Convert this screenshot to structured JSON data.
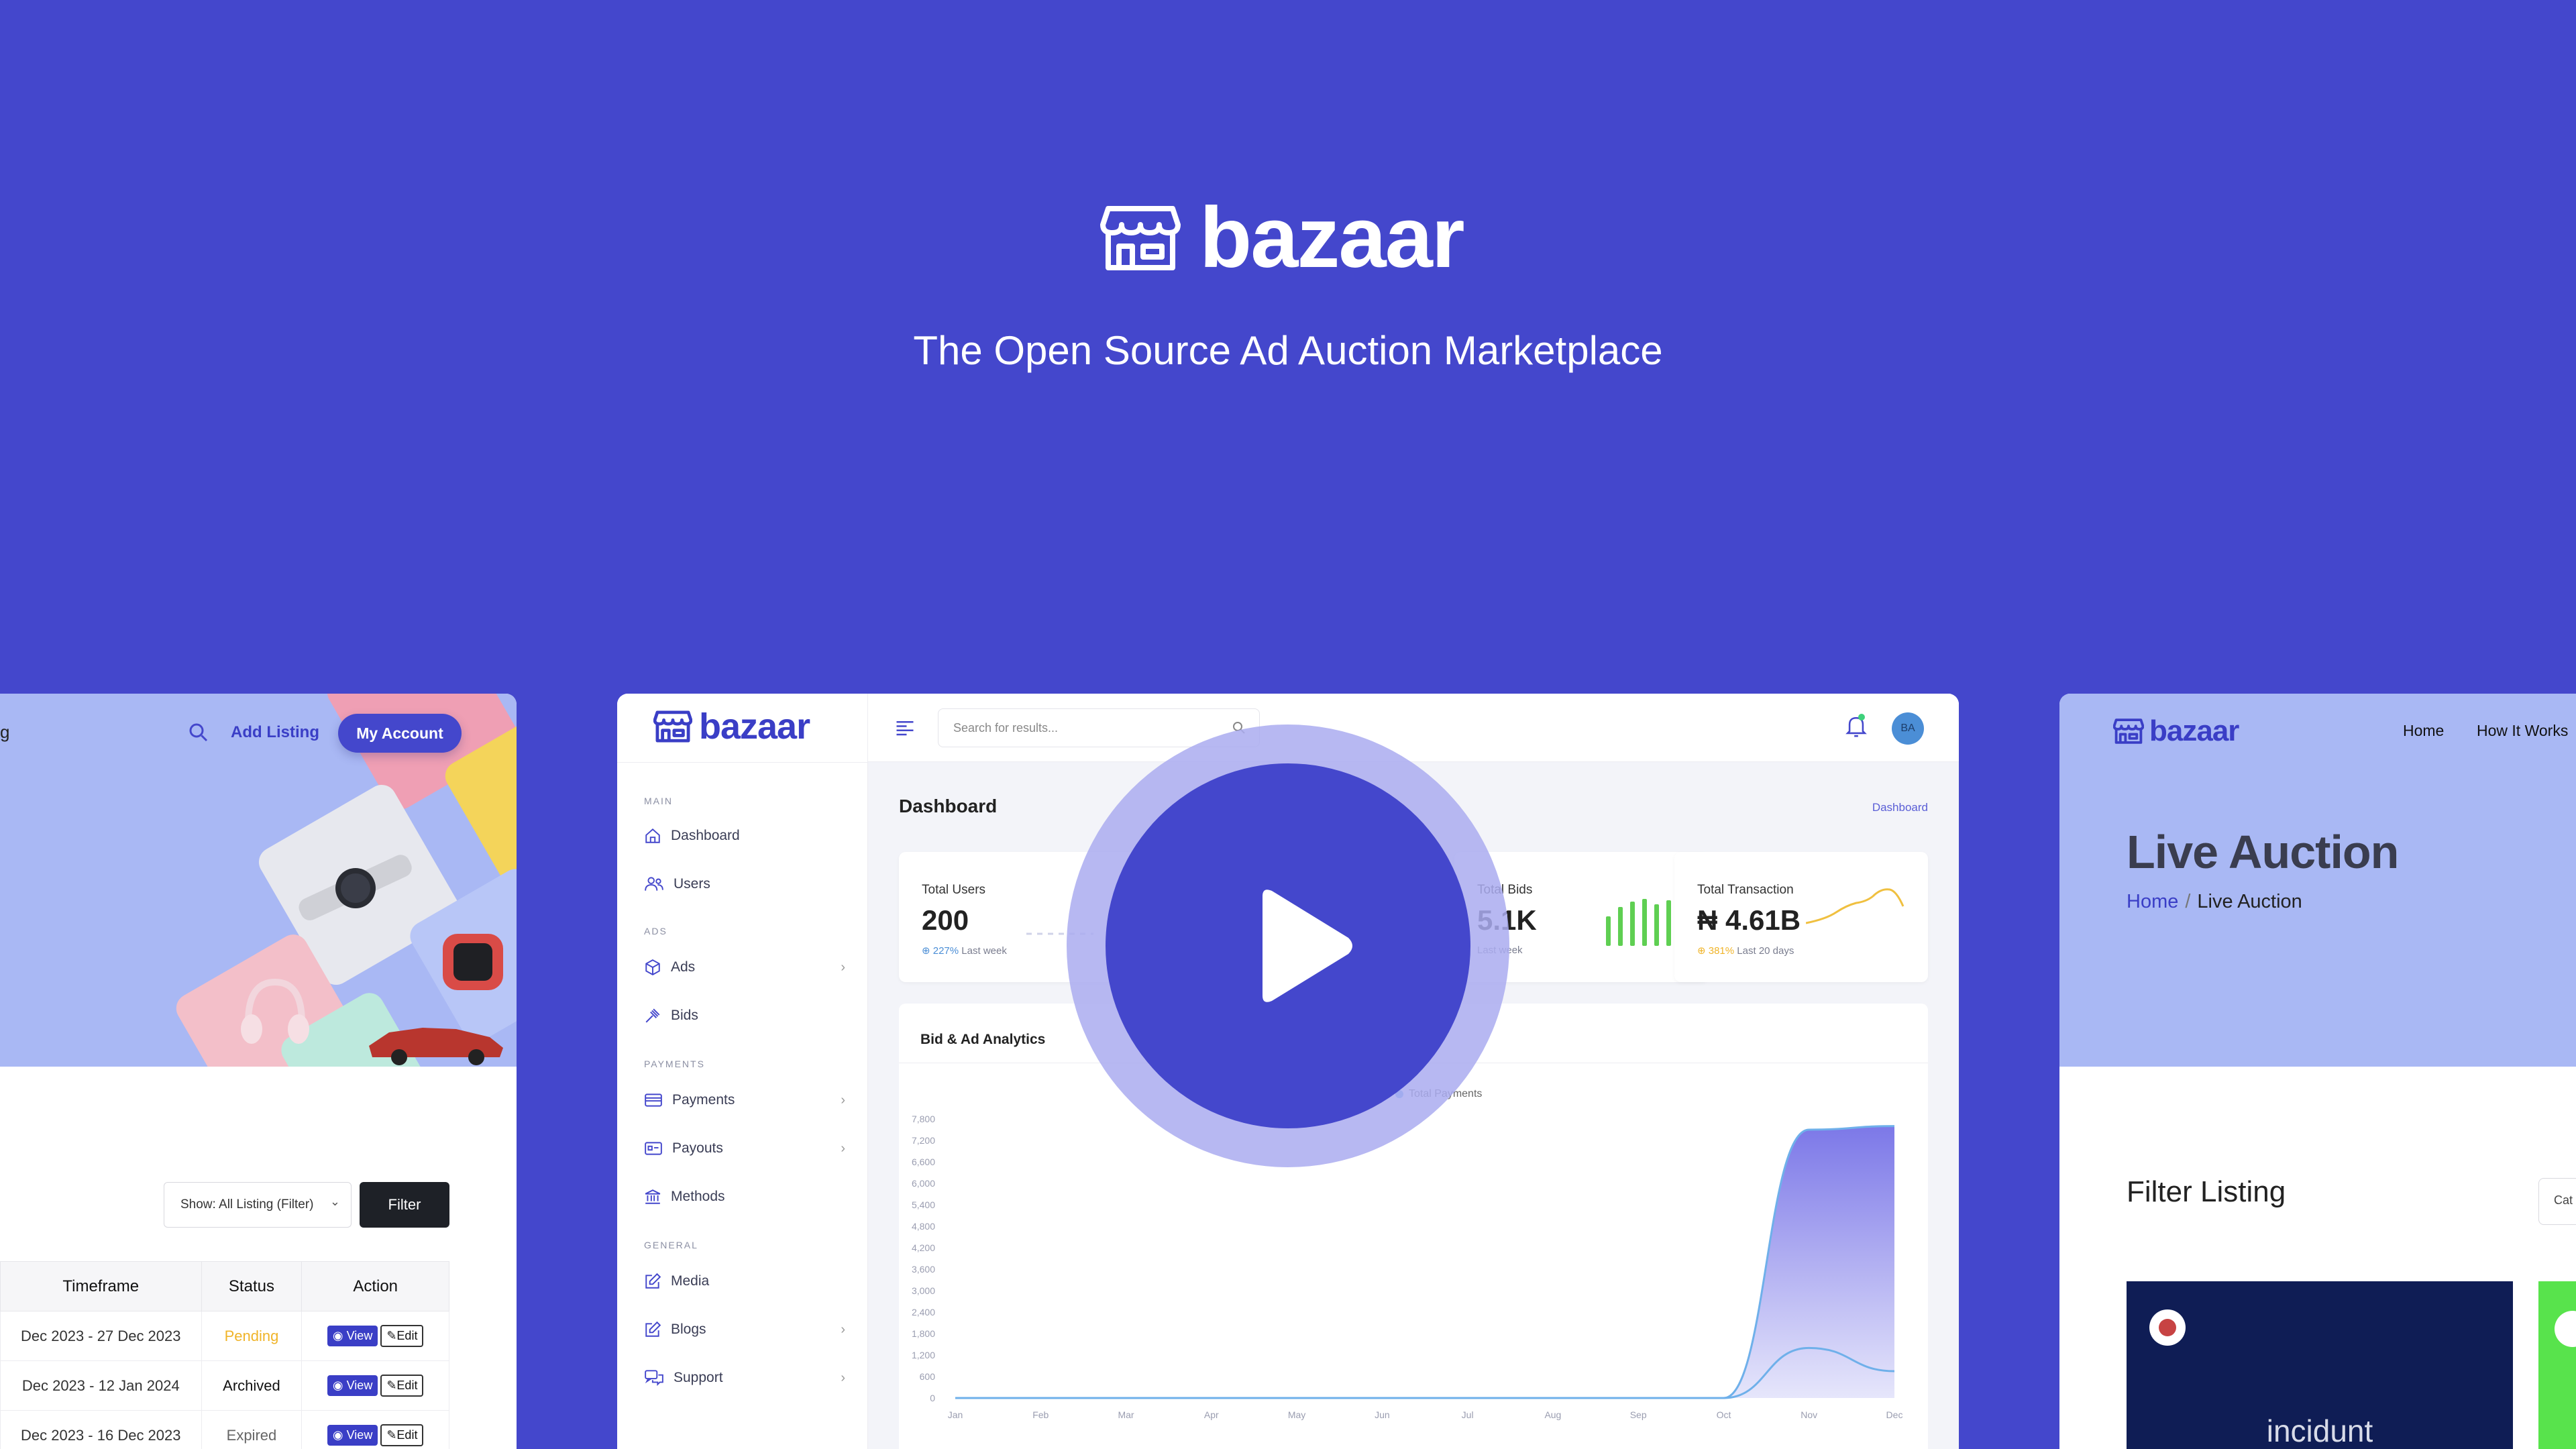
{
  "hero": {
    "brand": "bazaar",
    "tagline": "The Open Source Ad Auction Marketplace",
    "background": "#4447cc"
  },
  "left_preview": {
    "nav_partial": "g",
    "add_listing": "Add Listing",
    "my_account": "My Account",
    "filter_select": "Show: All Listing (Filter)",
    "filter_button": "Filter",
    "table": {
      "headers": [
        "Timeframe",
        "Status",
        "Action"
      ],
      "rows": [
        {
          "timeframe": "Dec 2023 - 27 Dec 2023",
          "status": "Pending",
          "view": "View",
          "edit": "Edit"
        },
        {
          "timeframe": "Dec 2023 - 12 Jan 2024",
          "status": "Archived",
          "view": "View",
          "edit": "Edit"
        },
        {
          "timeframe": "Dec 2023 - 16 Dec 2023",
          "status": "Expired",
          "view": "View",
          "edit": "Edit"
        }
      ]
    }
  },
  "dashboard": {
    "brand": "bazaar",
    "search_placeholder": "Search for results...",
    "avatar": "BA",
    "sidebar": {
      "sections": [
        {
          "label": "MAIN",
          "items": [
            {
              "label": "Dashboard",
              "icon": "home-icon"
            },
            {
              "label": "Users",
              "icon": "users-icon"
            }
          ]
        },
        {
          "label": "ADS",
          "items": [
            {
              "label": "Ads",
              "icon": "box-icon",
              "arrow": true
            },
            {
              "label": "Bids",
              "icon": "gavel-icon"
            }
          ]
        },
        {
          "label": "PAYMENTS",
          "items": [
            {
              "label": "Payments",
              "icon": "card-icon",
              "arrow": true
            },
            {
              "label": "Payouts",
              "icon": "wallet-icon",
              "arrow": true
            },
            {
              "label": "Methods",
              "icon": "bank-icon"
            }
          ]
        },
        {
          "label": "GENERAL",
          "items": [
            {
              "label": "Media",
              "icon": "edit-icon"
            },
            {
              "label": "Blogs",
              "icon": "edit-icon",
              "arrow": true
            },
            {
              "label": "Support",
              "icon": "chat-icon",
              "arrow": true
            }
          ]
        }
      ]
    },
    "title": "Dashboard",
    "breadcrumb": "Dashboard",
    "stats": [
      {
        "label": "Total Users",
        "value": "200",
        "pct": "227%",
        "period": "Last week",
        "pct_color": "#4b8ed6"
      },
      {
        "label": "Total Bids",
        "value": "5.1K",
        "pct": "",
        "period": "Last week",
        "pct_color": "#3ed17b"
      },
      {
        "label": "Total Transaction",
        "value": "₦ 4.61B",
        "pct": "381%",
        "period": "Last 20 days",
        "pct_color": "#f0b429"
      }
    ],
    "analytics": {
      "title": "Bid & Ad Analytics",
      "legend": "Total Payments"
    }
  },
  "chart_data": {
    "type": "area",
    "title": "Bid & Ad Analytics",
    "categories": [
      "Jan",
      "Feb",
      "Mar",
      "Apr",
      "May",
      "Jun",
      "Jul",
      "Aug",
      "Sep",
      "Oct",
      "Nov",
      "Dec"
    ],
    "y_ticks": [
      0,
      600,
      1200,
      1800,
      2400,
      3000,
      3600,
      4200,
      4800,
      5400,
      6000,
      6600,
      7200,
      7800
    ],
    "ylim": [
      0,
      7800
    ],
    "series": [
      {
        "name": "",
        "values": [
          0,
          0,
          0,
          0,
          0,
          0,
          0,
          0,
          0,
          0,
          7500,
          7600
        ],
        "color": "#7c78e8"
      },
      {
        "name": "Total Payments",
        "values": [
          0,
          0,
          0,
          0,
          0,
          0,
          0,
          0,
          0,
          0,
          1400,
          750
        ],
        "color": "#6fb0ea"
      }
    ]
  },
  "right_preview": {
    "brand": "bazaar",
    "nav": [
      "Home",
      "How It Works"
    ],
    "title": "Live Auction",
    "crumb_home": "Home",
    "crumb_sep": "/",
    "crumb_current": "Live Auction",
    "filter_title": "Filter Listing",
    "category_partial": "Cat",
    "tile_text": "incidunt"
  }
}
